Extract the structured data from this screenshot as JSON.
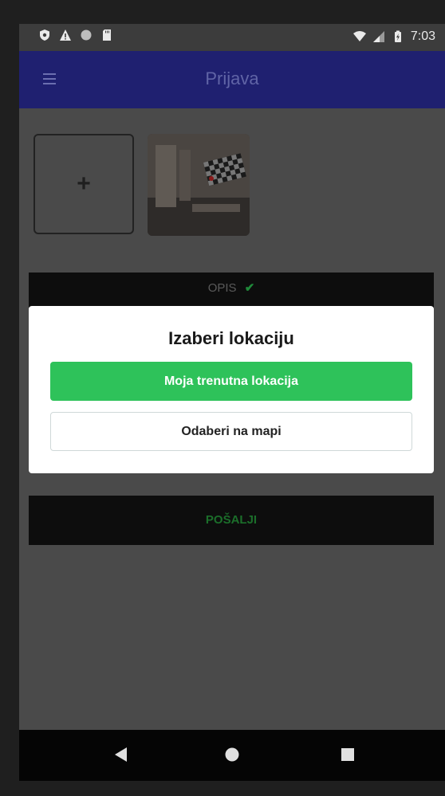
{
  "status_bar": {
    "time": "7:03",
    "icons": [
      "shield-icon",
      "warning-icon",
      "circle-icon",
      "sd-card-icon",
      "wifi-icon",
      "signal-icon",
      "battery-icon"
    ]
  },
  "app_bar": {
    "title": "Prijava",
    "menu_icon": "hamburger-menu-icon"
  },
  "photos": {
    "add_symbol": "+",
    "thumbnail_icon": "room-photo-thumbnail"
  },
  "sections": {
    "opis_label": "OPIS",
    "opis_check": "✔",
    "send_label": "POŠALJI"
  },
  "dialog": {
    "title": "Izaberi lokaciju",
    "primary_button": "Moja trenutna lokacija",
    "secondary_button": "Odaberi na mapi"
  },
  "nav_bar": {
    "icons": [
      "back-icon",
      "home-icon",
      "recents-icon"
    ]
  },
  "colors": {
    "app_bar": "#1f2070",
    "primary_button": "#2ec25a",
    "send_text": "#1b6e2a",
    "overlay_background": "#4a4a4a"
  }
}
